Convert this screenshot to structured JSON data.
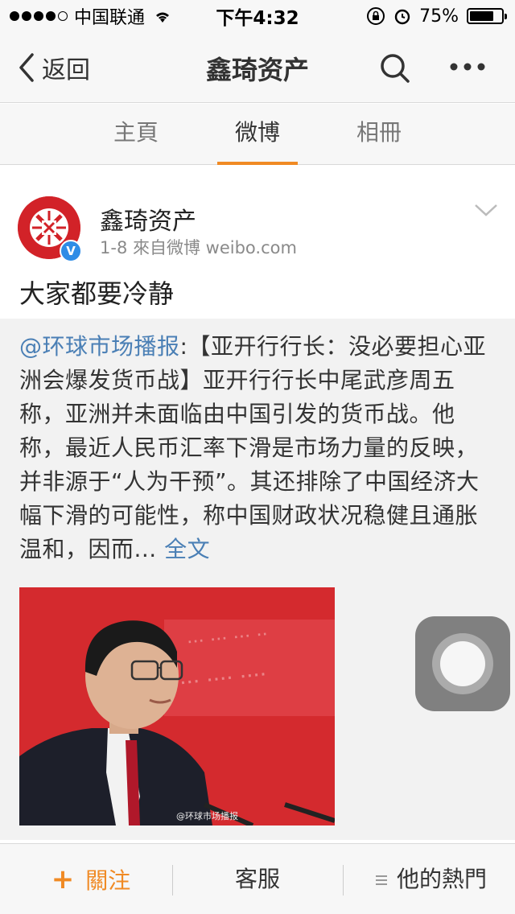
{
  "status_bar": {
    "carrier": "中国联通",
    "time": "下午4:32",
    "battery_percent": "75%",
    "battery_level": 0.75
  },
  "nav": {
    "back_label": "返回",
    "title": "鑫琦资产"
  },
  "tabs": [
    {
      "label": "主頁",
      "active": false
    },
    {
      "label": "微博",
      "active": true
    },
    {
      "label": "相冊",
      "active": false
    }
  ],
  "post": {
    "author": "鑫琦资产",
    "meta": "1-8  來自微博 weibo.com",
    "verified_badge": "V",
    "text": "大家都要冷静",
    "repost": {
      "mention": "@环球市场播报",
      "body": ":【亚开行行长：没必要担心亚洲会爆发货币战】亚开行行长中尾武彦周五称，亚洲并未面临由中国引发的货币战。他称，最近人民币汇率下滑是市场力量的反映，并非源于“人为干预”。其还排除了中国经济大幅下滑的可能性，称中国财政状况稳健且通胀温和，因而...",
      "full_text_link": "全文",
      "image_watermark": "@环球市场播报"
    }
  },
  "bottom_bar": {
    "follow": "關注",
    "follow_plus": "+",
    "service": "客服",
    "hot": "他的熱門"
  },
  "colors": {
    "accent": "#f08a24",
    "link": "#4a7fb5",
    "brand_red": "#d22228",
    "verified_blue": "#2e8ce6"
  },
  "icons": [
    "signal-dots-icon",
    "wifi-icon",
    "lock-rotation-icon",
    "alarm-icon",
    "battery-icon",
    "back-chevron-icon",
    "search-icon",
    "more-icon",
    "chevron-down-icon",
    "verified-icon",
    "list-icon"
  ]
}
